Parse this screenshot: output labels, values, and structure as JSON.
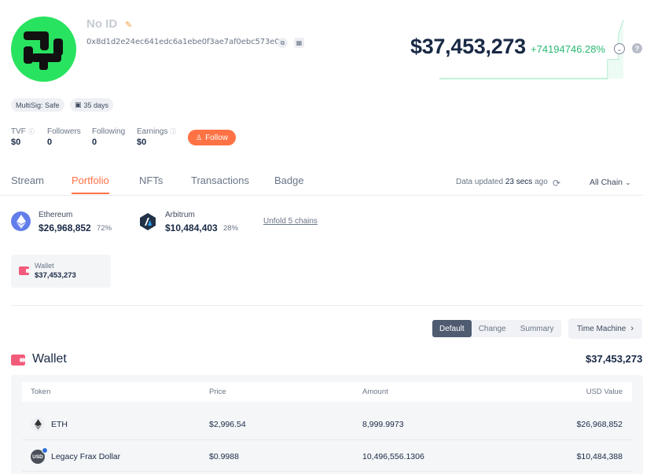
{
  "profile": {
    "name": "No ID",
    "address": "0x8d1d2e24ec641edc6a1ebe0f3ae7af0ebc573e0d",
    "tags": [
      "MultiSig: Safe",
      "35 days"
    ]
  },
  "networth": {
    "value": "$37,453,273",
    "change": "+74194746.28%"
  },
  "stats": [
    {
      "label": "TVF",
      "value": "$0"
    },
    {
      "label": "Followers",
      "value": "0"
    },
    {
      "label": "Following",
      "value": "0"
    },
    {
      "label": "Earnings",
      "value": "$0"
    }
  ],
  "follow_label": "Follow",
  "tabs": [
    {
      "label": "Stream"
    },
    {
      "label": "Portfolio"
    },
    {
      "label": "NFTs"
    },
    {
      "label": "Transactions"
    },
    {
      "label": "Badge"
    }
  ],
  "data_updated": {
    "prefix": "Data updated",
    "time": "23 secs",
    "suffix": "ago"
  },
  "chain_filter": "All Chain",
  "chains": [
    {
      "name": "Ethereum",
      "value": "$26,968,852",
      "percent": "72%"
    },
    {
      "name": "Arbitrum",
      "value": "$10,484,403",
      "percent": "28%"
    }
  ],
  "unfold_label": "Unfold 5 chains",
  "wallet_card": {
    "label": "Wallet",
    "value": "$37,453,273"
  },
  "view_modes": [
    "Default",
    "Change",
    "Summary"
  ],
  "time_machine": "Time Machine",
  "wallet_section": {
    "title": "Wallet",
    "total": "$37,453,273",
    "columns": [
      "Token",
      "Price",
      "Amount",
      "USD Value"
    ],
    "rows": [
      {
        "token": "ETH",
        "price": "$2,996.54",
        "amount": "8,999.9973",
        "usd": "$26,968,852"
      },
      {
        "token": "Legacy Frax Dollar",
        "price": "$0.9988",
        "amount": "10,496,556.1306",
        "usd": "$10,484,388"
      }
    ]
  },
  "colors": {
    "accent": "#ff7244",
    "positive": "#27b86f",
    "avatar": "#28e35f",
    "wallet": "#f25b7a"
  }
}
